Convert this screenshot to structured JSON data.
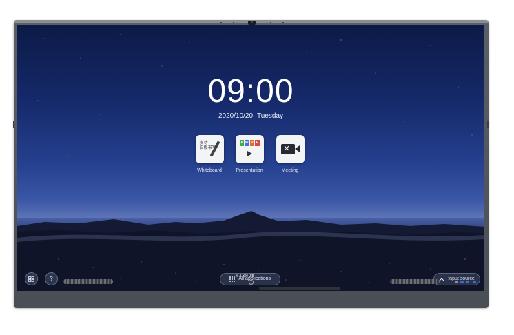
{
  "screen": {
    "time": "09:00",
    "date": "2020/10/20",
    "weekday": "Tuesday"
  },
  "apps": [
    {
      "label": "Whiteboard",
      "icon": "whiteboard-icon",
      "tile_text": [
        "多功",
        "白板书写"
      ]
    },
    {
      "label": "Presentation",
      "icon": "presentation-icon",
      "bar_letters": [
        "X",
        "W",
        "P",
        "P"
      ],
      "bar_colors": [
        "#4aa84f",
        "#3a78d8",
        "#e26a2c",
        "#d94a3b"
      ]
    },
    {
      "label": "Meeting",
      "icon": "meeting-icon"
    }
  ],
  "bottom_bar": {
    "all_apps_label": "All applications",
    "input_source_label": "Input source",
    "left_buttons": [
      {
        "icon": "windows-icon"
      },
      {
        "icon": "help-icon",
        "glyph": "?"
      }
    ]
  },
  "device": {
    "brand": "MAXHUB"
  },
  "colors": {
    "screen_top": "#0c1a46",
    "horizon": "#4a64ad",
    "bezel": "#55595f"
  }
}
